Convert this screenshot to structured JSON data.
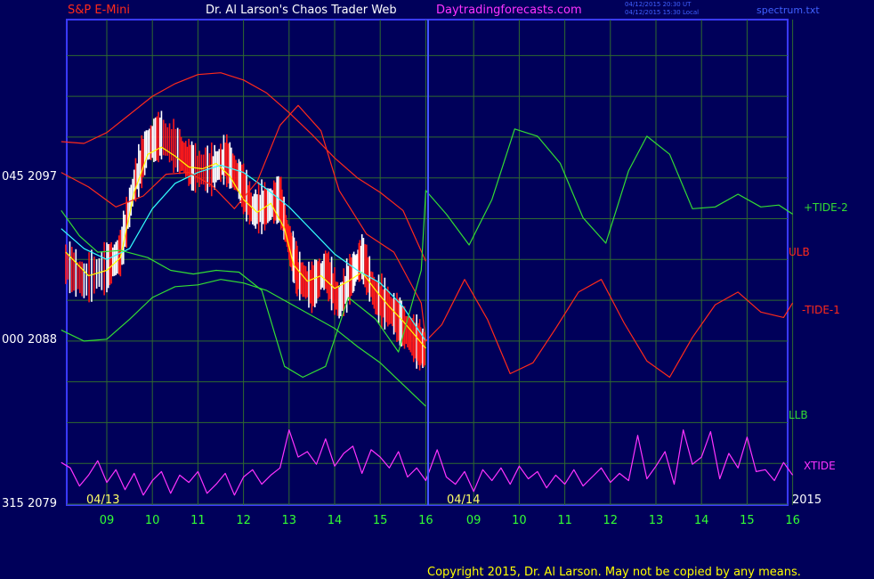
{
  "header": {
    "symbol": "S&P E-Mini",
    "site_title": "Dr. Al Larson's Chaos Trader Web",
    "site_url": "Daytradingforecasts.com",
    "stamp_line1": "04/12/2015 20:30 UT",
    "stamp_line2": "04/12/2015 15:30 Local",
    "source_file": "spectrum.txt"
  },
  "footer": {
    "copyright": "Copyright 2015, Dr. Al Larson. May not be copied by any means."
  },
  "colors": {
    "background": "#00005a",
    "plot_border": "#3a3aff",
    "grid": "#2f6a2f",
    "price_up": "#ffffff",
    "price_down": "#ff1a1a",
    "fast_ma": "#ffff00",
    "slow_ma": "#33ffff",
    "tide_red": "#ff2a1a",
    "tide_green": "#33dd33",
    "xtide": "#ff33ff"
  },
  "chart_data": {
    "type": "line",
    "title": "S&P E-Mini",
    "y_axis_labels": [
      {
        "left": "045",
        "right": "2097",
        "value": 2097
      },
      {
        "left": "000",
        "right": "2088",
        "value": 2088
      },
      {
        "left": "315",
        "right": "2079",
        "value": 2079
      }
    ],
    "ylim": [
      2079,
      2098
    ],
    "x_axis": {
      "day1_label": "04/13",
      "day2_label": "04/14",
      "year_label": "2015",
      "day1_hours": [
        "09",
        "10",
        "11",
        "12",
        "13",
        "14",
        "15",
        "16"
      ],
      "day2_hours": [
        "09",
        "10",
        "11",
        "12",
        "13",
        "14",
        "15",
        "16"
      ],
      "split_hour_label": "16"
    },
    "right_labels": [
      {
        "name": "+TIDE-2",
        "color": "#33dd33"
      },
      {
        "name": "ULB",
        "color": "#ff2a1a"
      },
      {
        "name": "-TIDE-1",
        "color": "#ff2a1a"
      },
      {
        "name": "LLB",
        "color": "#33dd33"
      },
      {
        "name": "XTIDE",
        "color": "#ff33ff"
      }
    ],
    "series": [
      {
        "name": "S&P E-Mini",
        "type": "price",
        "x": [
          8.1,
          8.5,
          9.0,
          9.3,
          9.6,
          9.9,
          10.2,
          10.6,
          10.9,
          11.3,
          11.6,
          11.9,
          12.2,
          12.5,
          12.8,
          13.0,
          13.2,
          13.5,
          13.8,
          14.1,
          14.4,
          14.6,
          14.9,
          15.2,
          15.5,
          15.8,
          16.0
        ],
        "y": [
          2092.2,
          2091.3,
          2092.0,
          2092.8,
          2096.6,
          2098.8,
          2099.3,
          2098.4,
          2097.5,
          2097.4,
          2098.0,
          2096.9,
          2095.2,
          2095.4,
          2095.8,
          2093.4,
          2091.6,
          2090.9,
          2091.9,
          2090.1,
          2091.7,
          2092.6,
          2090.4,
          2089.8,
          2088.8,
          2087.9,
          2087.4
        ]
      },
      {
        "name": "fast average",
        "x": [
          8.1,
          8.6,
          9.0,
          9.3,
          9.6,
          9.9,
          10.2,
          10.5,
          10.8,
          11.1,
          11.4,
          11.7,
          12.0,
          12.3,
          12.6,
          12.9,
          13.1,
          13.4,
          13.7,
          14.0,
          14.3,
          14.6,
          14.9,
          15.2,
          15.5,
          15.8,
          16.0
        ],
        "y": [
          2092.9,
          2091.6,
          2091.9,
          2092.6,
          2096.2,
          2098.3,
          2098.7,
          2098.2,
          2097.6,
          2097.5,
          2097.8,
          2097.1,
          2095.8,
          2095.1,
          2095.6,
          2094.2,
          2092.2,
          2091.3,
          2091.6,
          2090.9,
          2091.3,
          2091.8,
          2090.8,
          2089.9,
          2089.1,
          2088.2,
          2087.6
        ]
      },
      {
        "name": "slow average",
        "x": [
          8.0,
          8.5,
          9.0,
          9.5,
          10.0,
          10.5,
          11.0,
          11.5,
          12.0,
          12.5,
          13.0,
          13.5,
          14.0,
          14.5,
          15.0,
          15.5,
          16.0
        ],
        "y": [
          2094.2,
          2093.1,
          2092.5,
          2093.1,
          2095.3,
          2096.7,
          2097.3,
          2097.7,
          2097.3,
          2096.4,
          2095.4,
          2094.1,
          2092.8,
          2091.9,
          2091.2,
          2089.9,
          2088.0
        ]
      },
      {
        "name": "ULB",
        "x": [
          8.0,
          8.5,
          9.0,
          9.5,
          10.0,
          10.5,
          11.0,
          11.5,
          12.0,
          12.5,
          13.0,
          13.5,
          14.0,
          14.5,
          15.0,
          15.5,
          16.0
        ],
        "y": [
          2099.0,
          2098.9,
          2099.5,
          2100.5,
          2101.5,
          2102.2,
          2102.7,
          2102.8,
          2102.4,
          2101.7,
          2100.6,
          2099.4,
          2098.1,
          2097.0,
          2096.2,
          2095.2,
          2092.4
        ]
      },
      {
        "name": "LLB",
        "x": [
          8.0,
          8.5,
          9.0,
          9.5,
          10.0,
          10.5,
          11.0,
          11.5,
          12.0,
          12.5,
          13.0,
          13.5,
          14.0,
          14.5,
          15.0,
          15.5,
          16.0
        ],
        "y": [
          2088.6,
          2088.0,
          2088.1,
          2089.2,
          2090.4,
          2091.0,
          2091.1,
          2091.4,
          2091.2,
          2090.8,
          2090.1,
          2089.4,
          2088.7,
          2087.7,
          2086.8,
          2085.6,
          2084.4
        ]
      },
      {
        "name": "-TIDE-1",
        "x": [
          8.0,
          8.6,
          9.2,
          9.8,
          10.3,
          10.8,
          11.3,
          11.8,
          12.3,
          12.8,
          13.2,
          13.7,
          14.1,
          14.7,
          15.3,
          15.9,
          16.0,
          16.3,
          16.8,
          17.3,
          17.8,
          18.3,
          18.8,
          19.3,
          19.8,
          20.3,
          20.8,
          21.3,
          21.8,
          22.3,
          22.8,
          23.3,
          23.8,
          24.0
        ],
        "y": [
          2097.3,
          2096.5,
          2095.4,
          2096.0,
          2097.2,
          2097.3,
          2096.6,
          2095.3,
          2096.8,
          2099.9,
          2101.0,
          2099.6,
          2096.3,
          2093.9,
          2092.9,
          2090.1,
          2088.0,
          2088.9,
          2091.4,
          2089.2,
          2086.2,
          2086.8,
          2088.7,
          2090.7,
          2091.4,
          2089.0,
          2086.9,
          2086.0,
          2088.2,
          2090.0,
          2090.7,
          2089.6,
          2089.3,
          2090.1
        ]
      },
      {
        "name": "+TIDE-2",
        "x": [
          8.0,
          8.4,
          8.8,
          9.3,
          9.9,
          10.4,
          10.9,
          11.4,
          11.9,
          12.4,
          12.9,
          13.3,
          13.8,
          14.3,
          14.9,
          15.4,
          15.9,
          16.0,
          16.4,
          16.9,
          17.4,
          17.9,
          18.4,
          18.9,
          19.4,
          19.9,
          20.4,
          20.8,
          21.3,
          21.8,
          22.3,
          22.8,
          23.3,
          23.7,
          24.0
        ],
        "y": [
          2095.2,
          2093.8,
          2092.9,
          2093.0,
          2092.6,
          2091.9,
          2091.7,
          2091.9,
          2091.8,
          2090.8,
          2086.6,
          2086.0,
          2086.6,
          2090.4,
          2089.2,
          2087.4,
          2091.9,
          2096.3,
          2095.0,
          2093.3,
          2095.8,
          2099.7,
          2099.3,
          2097.8,
          2094.8,
          2093.4,
          2097.4,
          2099.3,
          2098.3,
          2095.3,
          2095.4,
          2096.1,
          2095.4,
          2095.5,
          2095.0
        ]
      },
      {
        "name": "XTIDE",
        "x": [
          8.0,
          8.2,
          8.4,
          8.6,
          8.8,
          9.0,
          9.2,
          9.4,
          9.6,
          9.8,
          10.0,
          10.2,
          10.4,
          10.6,
          10.8,
          11.0,
          11.2,
          11.4,
          11.6,
          11.8,
          12.0,
          12.2,
          12.4,
          12.6,
          12.8,
          13.0,
          13.2,
          13.4,
          13.6,
          13.8,
          14.0,
          14.2,
          14.4,
          14.6,
          14.8,
          15.0,
          15.2,
          15.4,
          15.6,
          15.8,
          16.0,
          16.2,
          16.4,
          16.6,
          16.8,
          17.0,
          17.2,
          17.4,
          17.6,
          17.8,
          18.0,
          18.2,
          18.4,
          18.6,
          18.8,
          19.0,
          19.2,
          19.4,
          19.6,
          19.8,
          20.0,
          20.2,
          20.4,
          20.6,
          20.8,
          21.0,
          21.2,
          21.4,
          21.6,
          21.8,
          22.0,
          22.2,
          22.4,
          22.6,
          22.8,
          23.0,
          23.2,
          23.4,
          23.6,
          23.8,
          24.0
        ],
        "y": [
          2081.3,
          2081.0,
          2080.0,
          2080.6,
          2081.4,
          2080.2,
          2080.9,
          2079.8,
          2080.7,
          2079.5,
          2080.3,
          2080.8,
          2079.6,
          2080.6,
          2080.2,
          2080.8,
          2079.6,
          2080.1,
          2080.7,
          2079.5,
          2080.5,
          2080.9,
          2080.1,
          2080.6,
          2081.0,
          2083.1,
          2081.6,
          2081.9,
          2081.2,
          2082.6,
          2081.1,
          2081.8,
          2082.2,
          2080.7,
          2082.0,
          2081.6,
          2081.0,
          2081.9,
          2080.5,
          2081.0,
          2080.3,
          2082.0,
          2080.5,
          2080.1,
          2080.8,
          2079.7,
          2080.9,
          2080.3,
          2081.0,
          2080.1,
          2081.1,
          2080.4,
          2080.8,
          2079.9,
          2080.6,
          2080.1,
          2080.9,
          2080.0,
          2080.5,
          2081.0,
          2080.2,
          2080.7,
          2080.3,
          2082.8,
          2080.4,
          2081.1,
          2081.9,
          2080.1,
          2083.1,
          2081.2,
          2081.6,
          2083.0,
          2080.4,
          2081.8,
          2081.0,
          2082.7,
          2080.8,
          2080.9,
          2080.3,
          2081.3,
          2080.6
        ]
      }
    ]
  }
}
